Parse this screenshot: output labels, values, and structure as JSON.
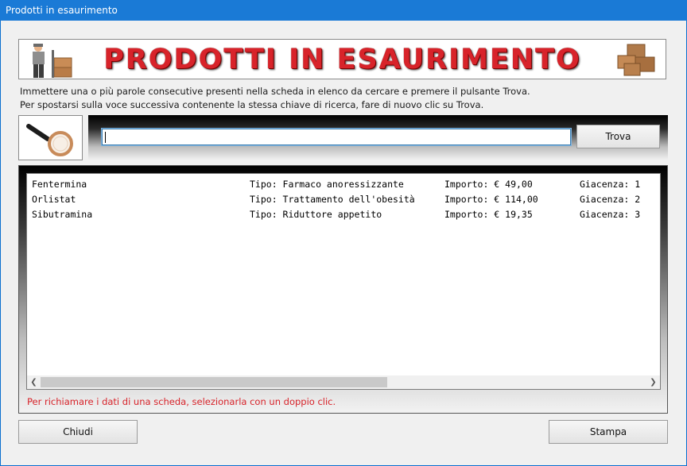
{
  "window": {
    "title": "Prodotti in esaurimento"
  },
  "banner": {
    "title": "PRODOTTI IN ESAURIMENTO"
  },
  "instructions": {
    "line1": "Immettere una o più parole consecutive presenti nella scheda in elenco da cercare e premere il pulsante Trova.",
    "line2": "Per spostarsi sulla voce successiva contenente la stessa chiave di ricerca, fare di nuovo clic su Trova."
  },
  "search": {
    "value": "",
    "button_label": "Trova"
  },
  "list": {
    "rows": [
      {
        "name": "Fentermina",
        "tipo": "Tipo: Farmaco anoressizzante",
        "importo": "Importo: € 49,00",
        "giacenza": "Giacenza: 1"
      },
      {
        "name": "Orlistat",
        "tipo": "Tipo: Trattamento dell'obesità",
        "importo": "Importo: € 114,00",
        "giacenza": "Giacenza: 2"
      },
      {
        "name": "Sibutramina",
        "tipo": "Tipo: Riduttore appetito",
        "importo": "Importo: € 19,35",
        "giacenza": "Giacenza: 3"
      }
    ],
    "hint": "Per richiamare i dati di una scheda, selezionarla con un doppio clic."
  },
  "footer": {
    "close_label": "Chiudi",
    "print_label": "Stampa"
  },
  "colors": {
    "titlebar": "#1a7ad6",
    "accent_red": "#d8232a"
  },
  "icons": {
    "banner_left": "delivery-man-icon",
    "banner_right": "boxes-icon",
    "search": "magnifier-icon"
  }
}
